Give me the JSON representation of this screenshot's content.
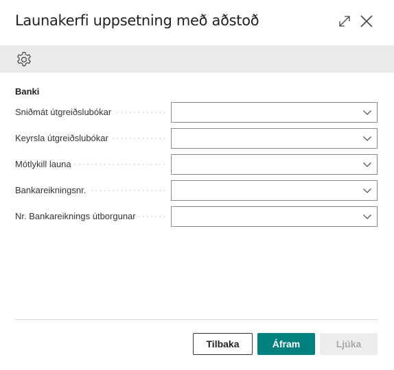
{
  "dialog": {
    "title": "Launakerfi uppsetning með aðstoð",
    "expand_icon": "expand-diagonal-icon",
    "close_icon": "close-x-icon"
  },
  "actionbar": {
    "settings_icon": "gear-icon"
  },
  "group": {
    "title": "Banki"
  },
  "fields": [
    {
      "label": "Sniðmát útgreiðslubókar",
      "value": ""
    },
    {
      "label": "Keyrsla útgreiðslubókar",
      "value": ""
    },
    {
      "label": "Mótlykill launa",
      "value": ""
    },
    {
      "label": "Bankareikningsnr.",
      "value": ""
    },
    {
      "label": "Nr. Bankareiknings útborgunar",
      "value": ""
    }
  ],
  "buttons": {
    "back": "Tilbaka",
    "next": "Áfram",
    "finish": "Ljúka"
  },
  "colors": {
    "primary": "#00807f",
    "actionbar": "#eaeaea",
    "disabled": "#ededed"
  }
}
